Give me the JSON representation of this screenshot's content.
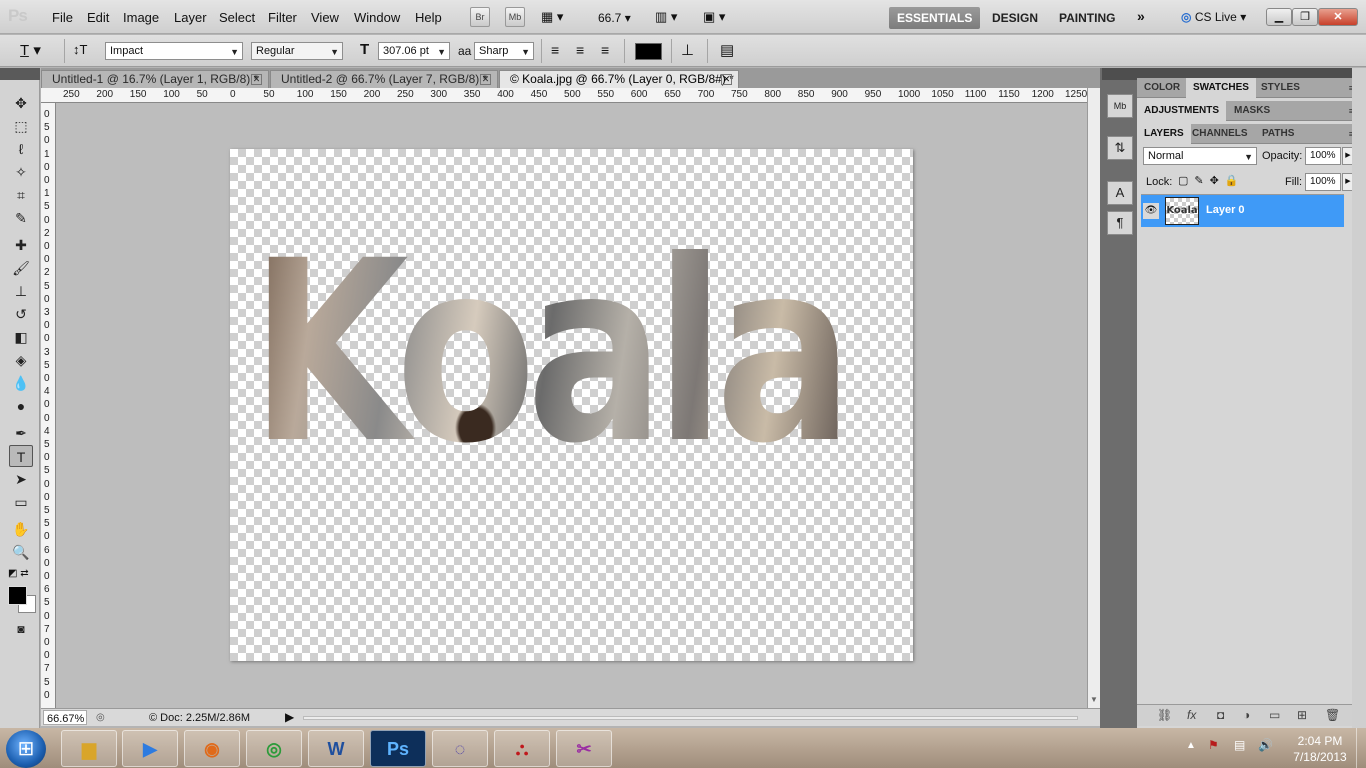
{
  "app": {
    "logo": "Ps"
  },
  "menu": [
    "File",
    "Edit",
    "Image",
    "Layer",
    "Select",
    "Filter",
    "View",
    "Window",
    "Help"
  ],
  "appbar": {
    "bridge": "Br",
    "minibridge": "Mb",
    "zoom": "66.7"
  },
  "workspaces": [
    "ESSENTIALS",
    "DESIGN",
    "PAINTING"
  ],
  "cslive": "CS Live",
  "options": {
    "font_family": "Impact",
    "font_style": "Regular",
    "font_size": "307.06 pt",
    "antialias_icon": "aa",
    "antialias": "Sharp"
  },
  "doc_tabs": [
    {
      "label": "Untitled-1 @ 16.7% (Layer 1, RGB/8) *"
    },
    {
      "label": "Untitled-2 @ 66.7% (Layer 7, RGB/8) *"
    },
    {
      "label": "© Koala.jpg @ 66.7% (Layer 0, RGB/8#) *"
    }
  ],
  "ruler_h": [
    "250",
    "200",
    "150",
    "100",
    "50",
    "0",
    "50",
    "100",
    "150",
    "200",
    "250",
    "300",
    "350",
    "400",
    "450",
    "500",
    "550",
    "600",
    "650",
    "700",
    "750",
    "800",
    "850",
    "900",
    "950",
    "1000",
    "1050",
    "1100",
    "1150",
    "1200",
    "1250"
  ],
  "ruler_v": [
    "0",
    "5",
    "0",
    "1",
    "0",
    "0",
    "1",
    "5",
    "0",
    "2",
    "0",
    "0",
    "2",
    "5",
    "0",
    "3",
    "0",
    "0",
    "3",
    "5",
    "0",
    "4",
    "0",
    "0",
    "4",
    "5",
    "0",
    "5",
    "0",
    "0",
    "5",
    "5",
    "0",
    "6",
    "0",
    "0",
    "6",
    "5",
    "0",
    "7",
    "0",
    "0",
    "7",
    "5",
    "0"
  ],
  "canvas_text": "Koala",
  "status": {
    "zoom": "66.67%",
    "doc": "Doc: 2.25M/2.86M"
  },
  "panels": {
    "row1": [
      "COLOR",
      "SWATCHES",
      "STYLES"
    ],
    "row2": [
      "ADJUSTMENTS",
      "MASKS"
    ],
    "row3": [
      "LAYERS",
      "CHANNELS",
      "PATHS"
    ],
    "blend_mode": "Normal",
    "opacity_label": "Opacity:",
    "opacity": "100%",
    "lock_label": "Lock:",
    "fill_label": "Fill:",
    "fill": "100%",
    "layer_name": "Layer 0",
    "layer_thumb": "Koala"
  },
  "tray": {
    "time": "2:04 PM",
    "date": "7/18/2013"
  }
}
